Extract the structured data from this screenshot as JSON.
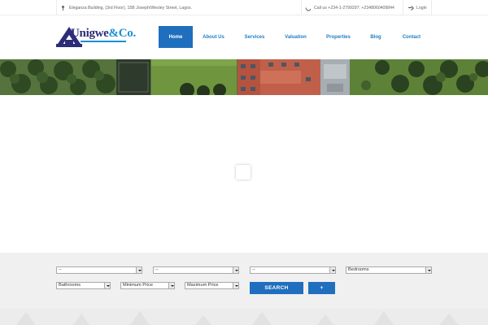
{
  "topbar": {
    "address": "Eleganza Building, (3rd Floor), 15B Joseph/Wesley Street, Lagos.",
    "phone": "Call us +234-1-2799297; +2348060409844",
    "login": "Login"
  },
  "logo": {
    "name": "Unigwe",
    "suffix": "&Co."
  },
  "nav": {
    "items": [
      {
        "label": "Home"
      },
      {
        "label": "About Us"
      },
      {
        "label": "Services"
      },
      {
        "label": "Valuation"
      },
      {
        "label": "Properties"
      },
      {
        "label": "Blog"
      },
      {
        "label": "Contact"
      }
    ]
  },
  "search": {
    "select1": "--",
    "select2": "--",
    "select3": "--",
    "bedrooms": "Bedrooms",
    "bathrooms": "Bathrooms",
    "min_price": "Minimum Price",
    "max_price": "Maximum Price",
    "search_label": "SEARCH",
    "more_label": "+"
  },
  "colors": {
    "accent": "#1f6fbe",
    "nav_text": "#1f7dc3",
    "brand": "#2c2c78"
  }
}
